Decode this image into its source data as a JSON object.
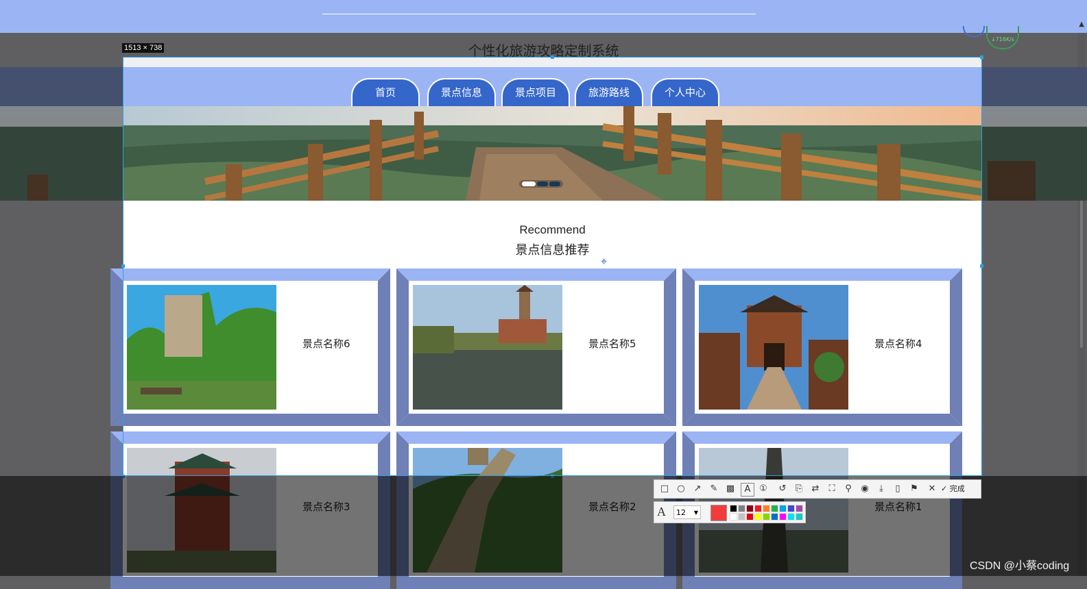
{
  "site_title": "个性化旅游攻略定制系统",
  "capture_size": "1513 × 738",
  "nav": {
    "tabs": [
      {
        "label": "首页"
      },
      {
        "label": "景点信息"
      },
      {
        "label": "景点项目"
      },
      {
        "label": "旅游路线"
      },
      {
        "label": "个人中心"
      }
    ]
  },
  "banner": {
    "active_slide": 1,
    "slide_count": 3
  },
  "recommend": {
    "title_en": "Recommend",
    "title_zh": "景点信息推荐"
  },
  "cards": [
    {
      "name": "景点名称6",
      "photo": "mountain-river-photo"
    },
    {
      "name": "景点名称5",
      "photo": "pagoda-lake-photo"
    },
    {
      "name": "景点名称4",
      "photo": "old-town-gate-photo"
    },
    {
      "name": "景点名称3",
      "photo": "pavilion-photo"
    },
    {
      "name": "景点名称2",
      "photo": "great-wall-photo"
    },
    {
      "name": "景点名称1",
      "photo": "stone-pillar-photo"
    }
  ],
  "toolbar": {
    "tools": [
      "rectangle-icon",
      "ellipse-icon",
      "arrow-icon",
      "pen-icon",
      "mosaic-icon",
      "text-icon",
      "number-icon",
      "undo-icon",
      "ocr-icon",
      "translate-icon",
      "long-screenshot-icon",
      "pin-icon",
      "record-icon",
      "download-icon",
      "phone-icon",
      "bookmark-icon",
      "close-icon"
    ],
    "done_label": "完成"
  },
  "text_settings": {
    "font_size": "12",
    "current_color": "#f03c3c",
    "palette": [
      "#000000",
      "#7f7f7f",
      "#880015",
      "#ed1c24",
      "#ff7f27",
      "#22b14c",
      "#00a2e8",
      "#3f48cc",
      "#a349a4",
      "#ffffff",
      "#c3c3c3",
      "#e8000f",
      "#ffff00",
      "#8fd400",
      "#0070c0",
      "#ff00ff",
      "#00e5e5",
      "#19c8c8"
    ]
  },
  "watermark": "CSDN @小蔡coding",
  "network_speed": "↓716K/s",
  "colors": {
    "nav_bg": "#9bb4f4",
    "tab_bg": "#3566c9",
    "card_light": "#9bb4f4",
    "card_dark": "#6e80b5",
    "selection": "#2e9fe6"
  }
}
